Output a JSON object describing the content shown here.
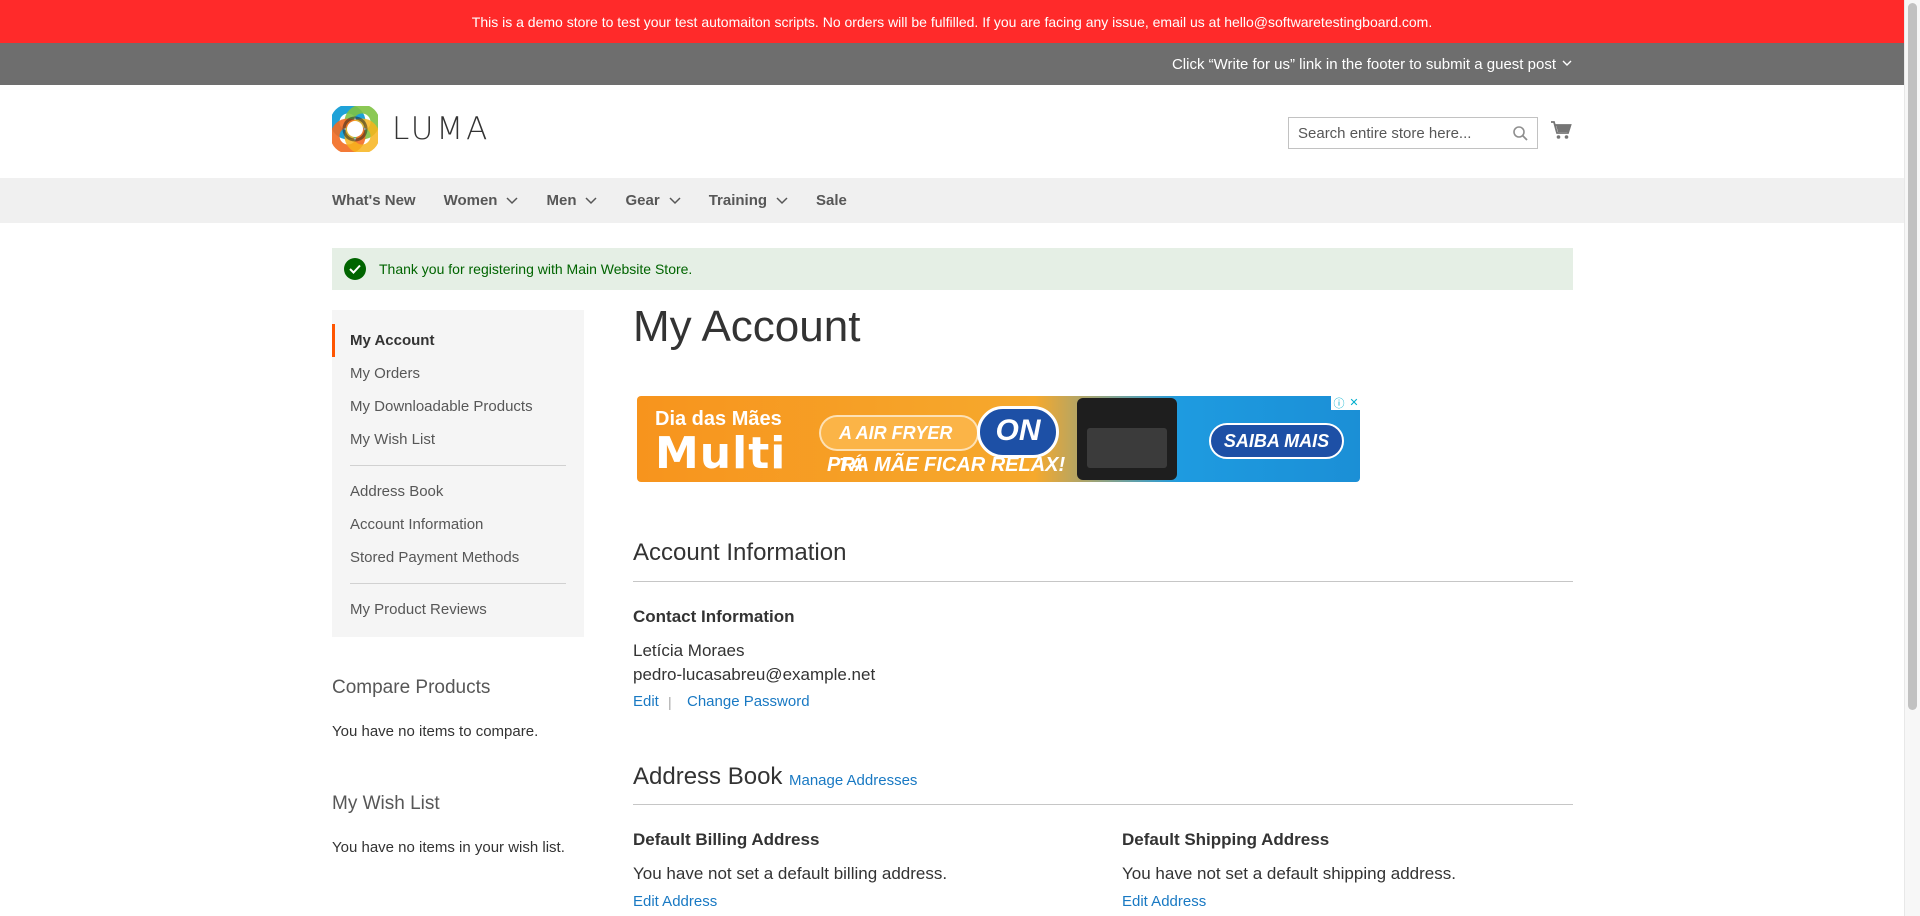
{
  "demo_notice": "This is a demo store to test your test automaiton scripts. No orders will be fulfilled. If you are facing any issue, email us at hello@softwaretestingboard.com.",
  "promo": {
    "text": "Click “Write for us” link in the footer to submit a guest post"
  },
  "logo": {
    "text": "LUMA"
  },
  "search": {
    "placeholder": "Search entire store here..."
  },
  "nav": {
    "items": [
      {
        "label": "What's New",
        "has_dropdown": false
      },
      {
        "label": "Women",
        "has_dropdown": true
      },
      {
        "label": "Men",
        "has_dropdown": true
      },
      {
        "label": "Gear",
        "has_dropdown": true
      },
      {
        "label": "Training",
        "has_dropdown": true
      },
      {
        "label": "Sale",
        "has_dropdown": false
      }
    ]
  },
  "message": {
    "text": "Thank you for registering with Main Website Store."
  },
  "sidebar": {
    "group1": [
      "My Account",
      "My Orders",
      "My Downloadable Products",
      "My Wish List"
    ],
    "group2": [
      "Address Book",
      "Account Information",
      "Stored Payment Methods"
    ],
    "group3": [
      "My Product Reviews"
    ],
    "active": "My Account"
  },
  "compare": {
    "title": "Compare Products",
    "empty": "You have no items to compare."
  },
  "wishlist": {
    "title": "My Wish List",
    "empty": "You have no items in your wish list."
  },
  "page_title": "My Account",
  "ad": {
    "line1": "Dia das Mães",
    "line2": "Multi",
    "pill": "A AIR FRYER TÁ",
    "on": "ON",
    "tagline": "PRA MÃE FICAR RELAX!",
    "cta": "SAIBA MAIS"
  },
  "account_info": {
    "title": "Account Information",
    "contact_title": "Contact Information",
    "name": "Letícia Moraes",
    "email": "pedro-lucasabreu@example.net",
    "edit": "Edit",
    "separator": "|",
    "change_password": "Change Password"
  },
  "address_book": {
    "title": "Address Book",
    "manage": "Manage Addresses",
    "billing_title": "Default Billing Address",
    "billing_text": "You have not set a default billing address.",
    "billing_edit": "Edit Address",
    "shipping_title": "Default Shipping Address",
    "shipping_text": "You have not set a default shipping address.",
    "shipping_edit": "Edit Address"
  },
  "colors": {
    "demo_bar": "#ff2a2a",
    "promo_bar": "#6e6e6e",
    "nav_bg": "#f0f0f0",
    "success_bg": "#e5efe5",
    "success_text": "#006400",
    "link": "#1979c3",
    "active_marker": "#ff5501"
  }
}
